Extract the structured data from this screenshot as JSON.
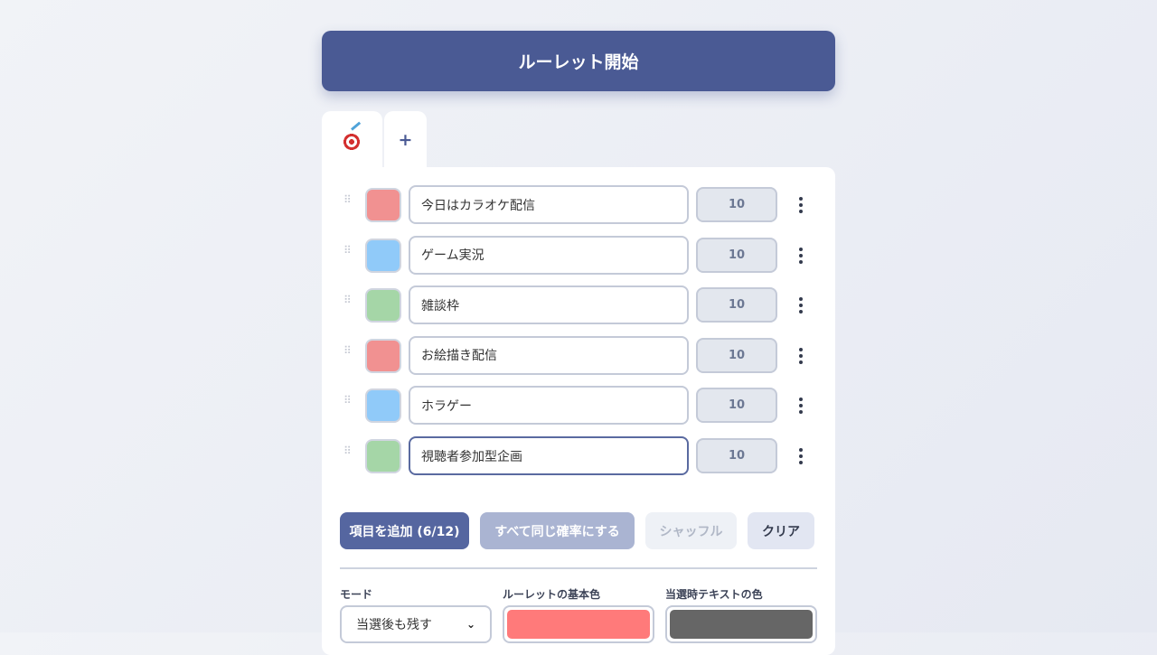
{
  "start_button": {
    "label": "ルーレット開始"
  },
  "tabs": {
    "active_icon": "target-dart-icon",
    "add_label": "+"
  },
  "items": [
    {
      "name": "今日はカラオケ配信",
      "weight": "10",
      "color": "#f19191"
    },
    {
      "name": "ゲーム実況",
      "weight": "10",
      "color": "#90caf9"
    },
    {
      "name": "雑談枠",
      "weight": "10",
      "color": "#a5d6a7"
    },
    {
      "name": "お絵描き配信",
      "weight": "10",
      "color": "#f19191"
    },
    {
      "name": "ホラゲー",
      "weight": "10",
      "color": "#90caf9"
    },
    {
      "name": "視聴者参加型企画",
      "weight": "10",
      "color": "#a5d6a7"
    }
  ],
  "actions": {
    "add_label": "項目を追加 (6/12)",
    "equal_label": "すべて同じ確率にする",
    "shuffle_label": "シャッフル",
    "clear_label": "クリア"
  },
  "settings": {
    "mode_label": "モード",
    "mode_value": "当選後も残す",
    "base_color_label": "ルーレットの基本色",
    "base_color": "#ff7a7a",
    "winner_text_color_label": "当選時テキストの色",
    "winner_text_color": "#666666"
  },
  "colors": {
    "accent": "#4a5a94",
    "button_primary": "#5566a0"
  }
}
